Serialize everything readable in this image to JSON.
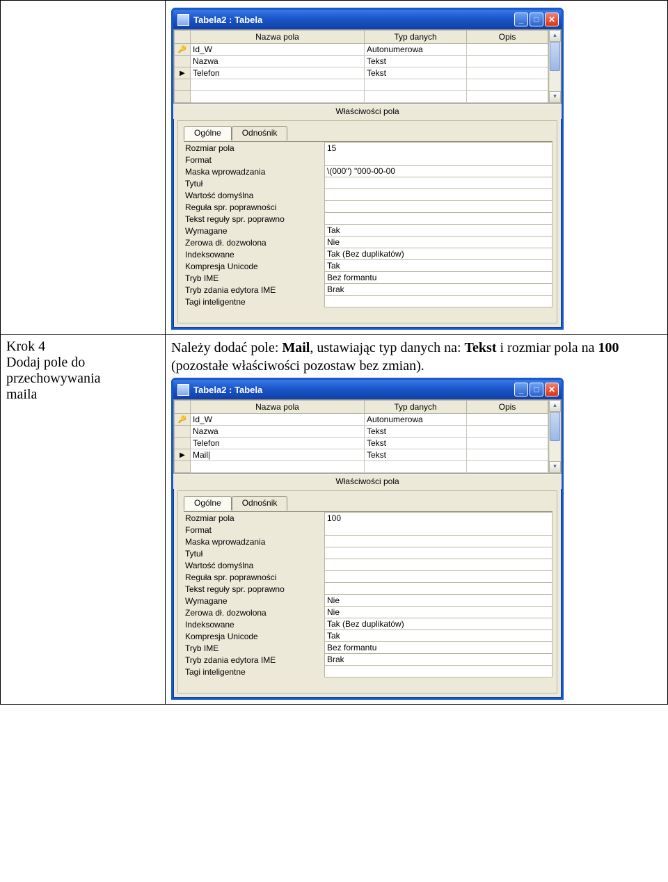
{
  "row1": {
    "leftText": "",
    "win": {
      "title": "Tabela2 : Tabela",
      "gridHeaders": [
        "Nazwa pola",
        "Typ danych",
        "Opis"
      ],
      "rows": [
        {
          "sel": "key",
          "name": "Id_W",
          "type": "Autonumerowa",
          "desc": ""
        },
        {
          "sel": "",
          "name": "Nazwa",
          "type": "Tekst",
          "desc": ""
        },
        {
          "sel": "cur",
          "name": "Telefon",
          "type": "Tekst",
          "desc": ""
        },
        {
          "sel": "",
          "name": "",
          "type": "",
          "desc": ""
        },
        {
          "sel": "",
          "name": "",
          "type": "",
          "desc": ""
        }
      ],
      "propTitle": "Właściwości pola",
      "tabs": [
        "Ogólne",
        "Odnośnik"
      ],
      "props": [
        {
          "l": "Rozmiar pola",
          "v": "15"
        },
        {
          "l": "Format",
          "v": ""
        },
        {
          "l": "Maska wprowadzania",
          "v": "\\(000\") \"000-00-00"
        },
        {
          "l": "Tytuł",
          "v": ""
        },
        {
          "l": "Wartość domyślna",
          "v": ""
        },
        {
          "l": "Reguła spr. poprawności",
          "v": ""
        },
        {
          "l": "Tekst reguły spr. poprawno",
          "v": ""
        },
        {
          "l": "Wymagane",
          "v": "Tak"
        },
        {
          "l": "Zerowa dł. dozwolona",
          "v": "Nie"
        },
        {
          "l": "Indeksowane",
          "v": "Tak (Bez duplikatów)"
        },
        {
          "l": "Kompresja Unicode",
          "v": "Tak"
        },
        {
          "l": "Tryb IME",
          "v": "Bez formantu"
        },
        {
          "l": "Tryb zdania edytora IME",
          "v": "Brak"
        },
        {
          "l": "Tagi inteligentne",
          "v": ""
        }
      ]
    }
  },
  "row2": {
    "leftLines": [
      "Krok 4",
      "Dodaj pole do",
      "przechowywania",
      "maila"
    ],
    "instr": {
      "pre": "Należy dodać pole: ",
      "b1": "Mail",
      "mid1": ", ustawiając typ danych na: ",
      "b2": "Tekst",
      "mid2": " i rozmiar pola na ",
      "b3": "100",
      "post": " (pozostałe właściwości pozostaw bez zmian)."
    },
    "win": {
      "title": "Tabela2 : Tabela",
      "gridHeaders": [
        "Nazwa pola",
        "Typ danych",
        "Opis"
      ],
      "rows": [
        {
          "sel": "key",
          "name": "Id_W",
          "type": "Autonumerowa",
          "desc": ""
        },
        {
          "sel": "",
          "name": "Nazwa",
          "type": "Tekst",
          "desc": ""
        },
        {
          "sel": "",
          "name": "Telefon",
          "type": "Tekst",
          "desc": ""
        },
        {
          "sel": "cur",
          "name": "Mail|",
          "type": "Tekst",
          "desc": ""
        },
        {
          "sel": "",
          "name": "",
          "type": "",
          "desc": ""
        }
      ],
      "propTitle": "Właściwości pola",
      "tabs": [
        "Ogólne",
        "Odnośnik"
      ],
      "props": [
        {
          "l": "Rozmiar pola",
          "v": "100"
        },
        {
          "l": "Format",
          "v": ""
        },
        {
          "l": "Maska wprowadzania",
          "v": ""
        },
        {
          "l": "Tytuł",
          "v": ""
        },
        {
          "l": "Wartość domyślna",
          "v": ""
        },
        {
          "l": "Reguła spr. poprawności",
          "v": ""
        },
        {
          "l": "Tekst reguły spr. poprawno",
          "v": ""
        },
        {
          "l": "Wymagane",
          "v": "Nie"
        },
        {
          "l": "Zerowa dł. dozwolona",
          "v": "Nie"
        },
        {
          "l": "Indeksowane",
          "v": "Tak (Bez duplikatów)"
        },
        {
          "l": "Kompresja Unicode",
          "v": "Tak"
        },
        {
          "l": "Tryb IME",
          "v": "Bez formantu"
        },
        {
          "l": "Tryb zdania edytora IME",
          "v": "Brak"
        },
        {
          "l": "Tagi inteligentne",
          "v": ""
        }
      ]
    }
  }
}
